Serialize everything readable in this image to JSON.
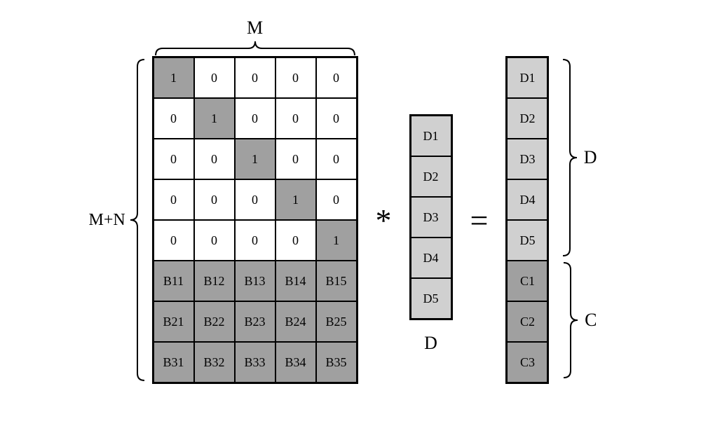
{
  "labels": {
    "topM": "M",
    "leftMN": "M+N",
    "rightD": "D",
    "rightC": "C",
    "vecD": "D",
    "mult": "*",
    "eq": "="
  },
  "matrixA": [
    [
      "1",
      "0",
      "0",
      "0",
      "0"
    ],
    [
      "0",
      "1",
      "0",
      "0",
      "0"
    ],
    [
      "0",
      "0",
      "1",
      "0",
      "0"
    ],
    [
      "0",
      "0",
      "0",
      "1",
      "0"
    ],
    [
      "0",
      "0",
      "0",
      "0",
      "1"
    ],
    [
      "B11",
      "B12",
      "B13",
      "B14",
      "B15"
    ],
    [
      "B21",
      "B22",
      "B23",
      "B24",
      "B25"
    ],
    [
      "B31",
      "B32",
      "B33",
      "B34",
      "B35"
    ]
  ],
  "matrixA_shade": [
    [
      "g",
      "w",
      "w",
      "w",
      "w"
    ],
    [
      "w",
      "g",
      "w",
      "w",
      "w"
    ],
    [
      "w",
      "w",
      "g",
      "w",
      "w"
    ],
    [
      "w",
      "w",
      "w",
      "g",
      "w"
    ],
    [
      "w",
      "w",
      "w",
      "w",
      "g"
    ],
    [
      "g",
      "g",
      "g",
      "g",
      "g"
    ],
    [
      "g",
      "g",
      "g",
      "g",
      "g"
    ],
    [
      "g",
      "g",
      "g",
      "g",
      "g"
    ]
  ],
  "vectorD": [
    "D1",
    "D2",
    "D3",
    "D4",
    "D5"
  ],
  "vectorResult": [
    "D1",
    "D2",
    "D3",
    "D4",
    "D5",
    "C1",
    "C2",
    "C3"
  ],
  "vectorResult_shade": [
    "l",
    "l",
    "l",
    "l",
    "l",
    "g",
    "g",
    "g"
  ]
}
